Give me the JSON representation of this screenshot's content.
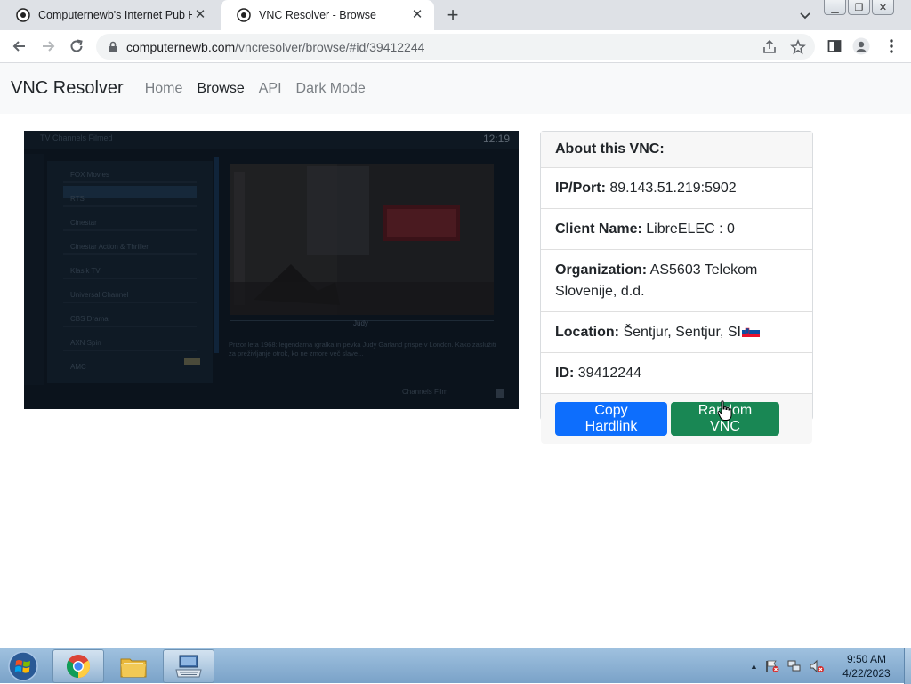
{
  "browser": {
    "tabs": [
      {
        "title": "Computernewb's Internet Pub Hub",
        "active": false
      },
      {
        "title": "VNC Resolver - Browse",
        "active": true
      }
    ],
    "url_domain": "computernewb.com",
    "url_path": "/vncresolver/browse/#id/39412244"
  },
  "site": {
    "brand": "VNC Resolver",
    "nav": [
      {
        "label": "Home",
        "active": false
      },
      {
        "label": "Browse",
        "active": true
      },
      {
        "label": "API",
        "active": false
      },
      {
        "label": "Dark Mode",
        "active": false
      }
    ]
  },
  "screenshot": {
    "top_left": "TV  Channels  Filmed",
    "clock": "12:19",
    "channels": [
      "FOX Movies",
      "RTS",
      "Cinestar",
      "Cinestar Action & Thriller",
      "Klasik TV",
      "Universal Channel",
      "CBS Drama",
      "AXN Spin",
      "AMC"
    ],
    "program_title": "Judy",
    "description": "Prizor leta 1968: legendarna igralka in pevka Judy Garland prispe v London. Kako zaslužiti za preživljanje otrok, ko ne zmore več slave...",
    "footer_text": "Channels  Film"
  },
  "vnc": {
    "header": "About this VNC:",
    "ip_port_label": "IP/Port:",
    "ip_port": "89.143.51.219:5902",
    "client_name_label": "Client Name:",
    "client_name": "LibreELEC : 0",
    "organization_label": "Organization:",
    "organization": "AS5603 Telekom Slovenije, d.d.",
    "location_label": "Location:",
    "location": "Šentjur, Sentjur, SI",
    "id_label": "ID:",
    "id": "39412244",
    "copy_button": "Copy Hardlink",
    "random_button": "Random VNC"
  },
  "taskbar": {
    "time": "9:50 AM",
    "date": "4/22/2023"
  },
  "colors": {
    "primary": "#0d6efd",
    "success": "#198754",
    "navbar_bg": "#f8f9fa"
  }
}
